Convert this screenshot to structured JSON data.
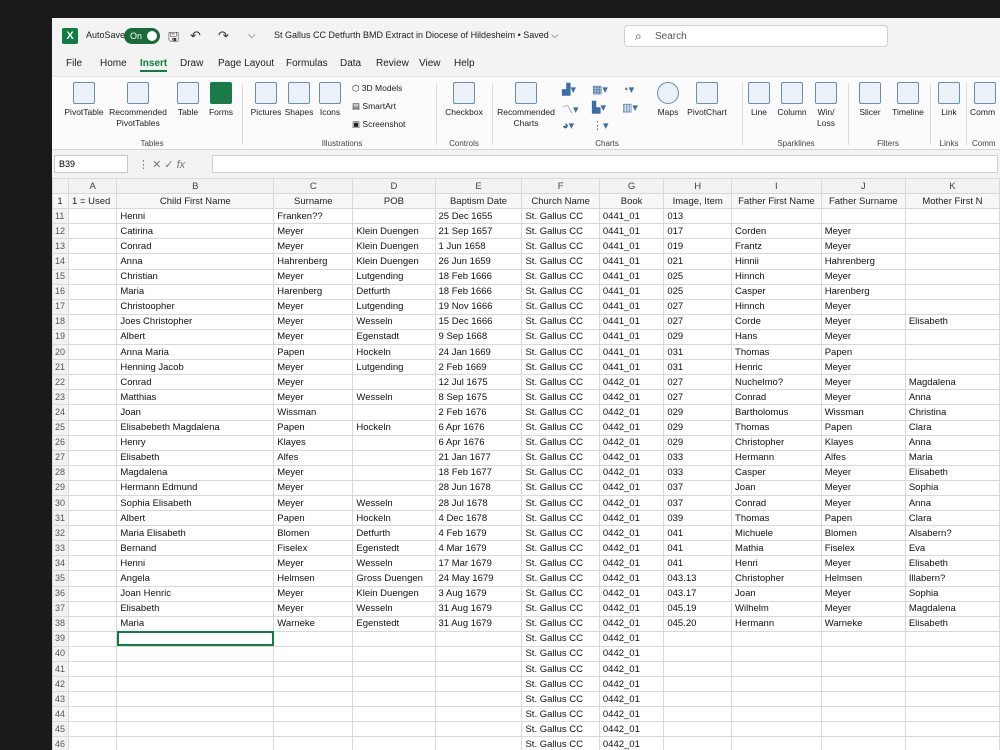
{
  "app": {
    "autosave_label": "AutoSave",
    "autosave_state": "On",
    "title": "St Gallus CC Detfurth BMD Extract in Diocese of Hildesheim • Saved ⌵",
    "search_placeholder": "Search",
    "accent": "#107c41"
  },
  "menu": {
    "tabs": [
      "File",
      "Home",
      "Insert",
      "Draw",
      "Page Layout",
      "Formulas",
      "Data",
      "Review",
      "View",
      "Help"
    ],
    "active": "Insert"
  },
  "ribbon": {
    "pivot": "PivotTable",
    "recommended_pivot": "Recommended PivotTables",
    "table": "Table",
    "forms": "Forms",
    "group_tables": "Tables",
    "pictures": "Pictures",
    "shapes": "Shapes",
    "icons": "Icons",
    "models_3d": "3D Models",
    "smartart": "SmartArt",
    "screenshot": "Screenshot",
    "group_illustrations": "Illustrations",
    "checkbox": "Checkbox",
    "group_controls": "Controls",
    "recommended_charts": "Recommended Charts",
    "maps": "Maps",
    "pivotchart": "PivotChart",
    "group_charts": "Charts",
    "line": "Line",
    "column": "Column",
    "winloss": "Win/ Loss",
    "group_sparklines": "Sparklines",
    "slicer": "Slicer",
    "timeline": "Timeline",
    "group_filters": "Filters",
    "link": "Link",
    "group_links": "Links",
    "comment": "Comm",
    "group_comments": "Comm"
  },
  "formula_bar": {
    "name_box": "B39",
    "fx": "fx"
  },
  "sheet": {
    "col_letters": [
      "",
      "A",
      "B",
      "C",
      "D",
      "E",
      "F",
      "G",
      "H",
      "I",
      "J",
      "K"
    ],
    "header_row_num": "1",
    "headers": [
      "1 = Used",
      "Child First Name",
      "Surname",
      "POB",
      "Baptism Date",
      "Church Name",
      "Book",
      "Image, Item",
      "Father First Name",
      "Father Surname",
      "Mother First N"
    ],
    "rows": [
      {
        "n": "11",
        "c": [
          "",
          "Henni",
          "Franken??",
          "",
          "25 Dec 1655",
          "St. Gallus CC",
          "0441_01",
          "013",
          "",
          "",
          ""
        ]
      },
      {
        "n": "12",
        "c": [
          "",
          "Catirina",
          "Meyer",
          "Klein Duengen",
          "21 Sep 1657",
          "St. Gallus CC",
          "0441_01",
          "017",
          "Corden",
          "Meyer",
          ""
        ]
      },
      {
        "n": "13",
        "c": [
          "",
          "Conrad",
          "Meyer",
          "Klein Duengen",
          "1 Jun 1658",
          "St. Gallus CC",
          "0441_01",
          "019",
          "Frantz",
          "Meyer",
          ""
        ]
      },
      {
        "n": "14",
        "c": [
          "",
          "Anna",
          "Hahrenberg",
          "Klein Duengen",
          "26 Jun 1659",
          "St. Gallus CC",
          "0441_01",
          "021",
          "Hinnii",
          "Hahrenberg",
          ""
        ]
      },
      {
        "n": "15",
        "c": [
          "",
          "Christian",
          "Meyer",
          "Lutgending",
          "18 Feb 1666",
          "St. Gallus CC",
          "0441_01",
          "025",
          "Hinnch",
          "Meyer",
          ""
        ]
      },
      {
        "n": "16",
        "c": [
          "",
          "Maria",
          "Harenberg",
          "Detfurth",
          "18 Feb 1666",
          "St. Gallus CC",
          "0441_01",
          "025",
          "Casper",
          "Harenberg",
          ""
        ]
      },
      {
        "n": "17",
        "c": [
          "",
          "Christoopher",
          "Meyer",
          "Lutgending",
          "19 Nov 1666",
          "St. Gallus CC",
          "0441_01",
          "027",
          "Hinnch",
          "Meyer",
          ""
        ]
      },
      {
        "n": "18",
        "c": [
          "",
          "Joes Christopher",
          "Meyer",
          "Wesseln",
          "15 Dec 1666",
          "St. Gallus CC",
          "0441_01",
          "027",
          "Corde",
          "Meyer",
          "Elisabeth"
        ]
      },
      {
        "n": "19",
        "c": [
          "",
          "Albert",
          "Meyer",
          "Egenstadt",
          "9 Sep 1668",
          "St. Gallus CC",
          "0441_01",
          "029",
          "Hans",
          "Meyer",
          ""
        ]
      },
      {
        "n": "20",
        "c": [
          "",
          "Anna Maria",
          "Papen",
          "Hockeln",
          "24 Jan 1669",
          "St. Gallus CC",
          "0441_01",
          "031",
          "Thomas",
          "Papen",
          ""
        ]
      },
      {
        "n": "21",
        "c": [
          "",
          "Henning Jacob",
          "Meyer",
          "Lutgending",
          "2 Feb 1669",
          "St. Gallus CC",
          "0441_01",
          "031",
          "Henric",
          "Meyer",
          ""
        ]
      },
      {
        "n": "22",
        "c": [
          "",
          "Conrad",
          "Meyer",
          "",
          "12 Jul 1675",
          "St. Gallus CC",
          "0442_01",
          "027",
          "Nuchelmo?",
          "Meyer",
          "Magdalena"
        ]
      },
      {
        "n": "23",
        "c": [
          "",
          "Matthias",
          "Meyer",
          "Wesseln",
          "8 Sep 1675",
          "St. Gallus CC",
          "0442_01",
          "027",
          "Conrad",
          "Meyer",
          "Anna"
        ]
      },
      {
        "n": "24",
        "c": [
          "",
          "Joan",
          "Wissman",
          "",
          "2 Feb 1676",
          "St. Gallus CC",
          "0442_01",
          "029",
          "Bartholomus",
          "Wissman",
          "Christina"
        ]
      },
      {
        "n": "25",
        "c": [
          "",
          "Elisabebeth Magdalena",
          "Papen",
          "Hockeln",
          "6 Apr 1676",
          "St. Gallus CC",
          "0442_01",
          "029",
          "Thomas",
          "Papen",
          "Clara"
        ]
      },
      {
        "n": "26",
        "c": [
          "",
          "Henry",
          "Klayes",
          "",
          "6 Apr 1676",
          "St. Gallus CC",
          "0442_01",
          "029",
          "Christopher",
          "Klayes",
          "Anna"
        ]
      },
      {
        "n": "27",
        "c": [
          "",
          "Elisabeth",
          "Alfes",
          "",
          "21 Jan 1677",
          "St. Gallus CC",
          "0442_01",
          "033",
          "Hermann",
          "Alfes",
          "Maria"
        ]
      },
      {
        "n": "28",
        "c": [
          "",
          "Magdalena",
          "Meyer",
          "",
          "18 Feb 1677",
          "St. Gallus CC",
          "0442_01",
          "033",
          "Casper",
          "Meyer",
          "Elisabeth"
        ]
      },
      {
        "n": "29",
        "c": [
          "",
          "Hermann Edmund",
          "Meyer",
          "",
          "28 Jun 1678",
          "St. Gallus CC",
          "0442_01",
          "037",
          "Joan",
          "Meyer",
          "Sophia"
        ]
      },
      {
        "n": "30",
        "c": [
          "",
          "Sophia Elisabeth",
          "Meyer",
          "Wesseln",
          "28 Jul 1678",
          "St. Gallus CC",
          "0442_01",
          "037",
          "Conrad",
          "Meyer",
          "Anna"
        ]
      },
      {
        "n": "31",
        "c": [
          "",
          "Albert",
          "Papen",
          "Hockeln",
          "4 Dec 1678",
          "St. Gallus CC",
          "0442_01",
          "039",
          "Thomas",
          "Papen",
          "Clara"
        ]
      },
      {
        "n": "32",
        "c": [
          "",
          "Maria Elisabeth",
          "Blomen",
          "Detfurth",
          "4 Feb 1679",
          "St. Gallus CC",
          "0442_01",
          "041",
          "Michuele",
          "Blomen",
          "Alsabern?"
        ]
      },
      {
        "n": "33",
        "c": [
          "",
          "Bernand",
          "Fiselex",
          "Egenstedt",
          "4 Mar 1679",
          "St. Gallus CC",
          "0442_01",
          "041",
          "Mathia",
          "Fiselex",
          "Eva"
        ]
      },
      {
        "n": "34",
        "c": [
          "",
          "Henni",
          "Meyer",
          "Wesseln",
          "17 Mar 1679",
          "St. Gallus CC",
          "0442_01",
          "041",
          "Henri",
          "Meyer",
          "Elisabeth"
        ]
      },
      {
        "n": "35",
        "c": [
          "",
          "Angela",
          "Helmsen",
          "Gross Duengen",
          "24 May 1679",
          "St. Gallus CC",
          "0442_01",
          "043.13",
          "Christopher",
          "Helmsen",
          "Illabern?"
        ]
      },
      {
        "n": "36",
        "c": [
          "",
          "Joan Henric",
          "Meyer",
          "Klein Duengen",
          "3 Aug 1679",
          "St. Gallus CC",
          "0442_01",
          "043.17",
          "Joan",
          "Meyer",
          "Sophia"
        ]
      },
      {
        "n": "37",
        "c": [
          "",
          "Elisabeth",
          "Meyer",
          "Wesseln",
          "31 Aug 1679",
          "St. Gallus CC",
          "0442_01",
          "045.19",
          "Wilhelm",
          "Meyer",
          "Magdalena"
        ]
      },
      {
        "n": "38",
        "c": [
          "",
          "Maria",
          "Warneke",
          "Egenstedt",
          "31 Aug 1679",
          "St. Gallus CC",
          "0442_01",
          "045.20",
          "Hermann",
          "Warneke",
          "Elisabeth"
        ]
      },
      {
        "n": "39",
        "c": [
          "",
          "",
          "",
          "",
          "",
          "St. Gallus CC",
          "0442_01",
          "",
          "",
          "",
          ""
        ]
      },
      {
        "n": "40",
        "c": [
          "",
          "",
          "",
          "",
          "",
          "St. Gallus CC",
          "0442_01",
          "",
          "",
          "",
          ""
        ]
      },
      {
        "n": "41",
        "c": [
          "",
          "",
          "",
          "",
          "",
          "St. Gallus CC",
          "0442_01",
          "",
          "",
          "",
          ""
        ]
      },
      {
        "n": "42",
        "c": [
          "",
          "",
          "",
          "",
          "",
          "St. Gallus CC",
          "0442_01",
          "",
          "",
          "",
          ""
        ]
      },
      {
        "n": "43",
        "c": [
          "",
          "",
          "",
          "",
          "",
          "St. Gallus CC",
          "0442_01",
          "",
          "",
          "",
          ""
        ]
      },
      {
        "n": "44",
        "c": [
          "",
          "",
          "",
          "",
          "",
          "St. Gallus CC",
          "0442_01",
          "",
          "",
          "",
          ""
        ]
      },
      {
        "n": "45",
        "c": [
          "",
          "",
          "",
          "",
          "",
          "St. Gallus CC",
          "0442_01",
          "",
          "",
          "",
          ""
        ]
      },
      {
        "n": "46",
        "c": [
          "",
          "",
          "",
          "",
          "",
          "St. Gallus CC",
          "0442_01",
          "",
          "",
          "",
          ""
        ]
      }
    ]
  }
}
